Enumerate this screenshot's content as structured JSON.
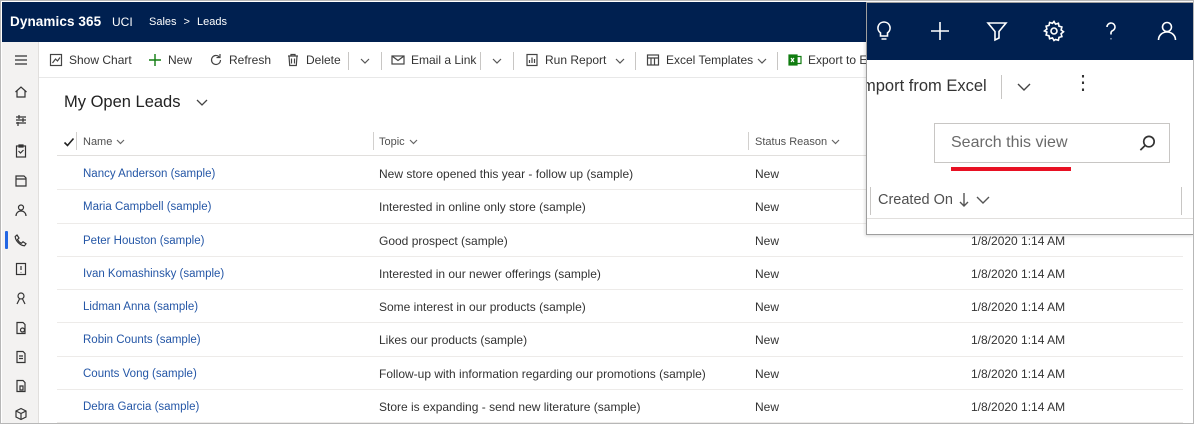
{
  "header": {
    "app_name": "Dynamics 365",
    "app_short": "UCI",
    "breadcrumb": [
      "Sales",
      "Leads"
    ]
  },
  "commands": {
    "show_chart": "Show Chart",
    "new": "New",
    "refresh": "Refresh",
    "delete": "Delete",
    "email_link": "Email a Link",
    "run_report": "Run Report",
    "excel_templates": "Excel Templates",
    "export": "Export to E",
    "import": "mport from Excel"
  },
  "view": {
    "title": "My Open Leads"
  },
  "columns": {
    "name": "Name",
    "topic": "Topic",
    "status": "Status Reason",
    "created": "Created On",
    "created_sort_icon": "arrow-down-icon"
  },
  "search": {
    "placeholder": "Search this view"
  },
  "rows": [
    {
      "name": "Nancy Anderson (sample)",
      "topic": "New store opened this year - follow up (sample)",
      "status": "New",
      "created": ""
    },
    {
      "name": "Maria Campbell (sample)",
      "topic": "Interested in online only store (sample)",
      "status": "New",
      "created": ""
    },
    {
      "name": "Peter Houston (sample)",
      "topic": "Good prospect (sample)",
      "status": "New",
      "created": "1/8/2020 1:14 AM"
    },
    {
      "name": "Ivan Komashinsky (sample)",
      "topic": "Interested in our newer offerings (sample)",
      "status": "New",
      "created": "1/8/2020 1:14 AM"
    },
    {
      "name": "Lidman Anna (sample)",
      "topic": "Some interest in our products (sample)",
      "status": "New",
      "created": "1/8/2020 1:14 AM"
    },
    {
      "name": "Robin Counts (sample)",
      "topic": "Likes our products (sample)",
      "status": "New",
      "created": "1/8/2020 1:14 AM"
    },
    {
      "name": "Counts Vong (sample)",
      "topic": "Follow-up with information regarding our promotions (sample)",
      "status": "New",
      "created": "1/8/2020 1:14 AM"
    },
    {
      "name": "Debra Garcia (sample)",
      "topic": "Store is expanding - send new literature (sample)",
      "status": "New",
      "created": "1/8/2020 1:14 AM"
    }
  ],
  "colors": {
    "nav": "#002050",
    "link": "#2456a6",
    "accent_green": "#107c10",
    "highlight_red": "#e81123",
    "active_nav": "#2266e3"
  }
}
